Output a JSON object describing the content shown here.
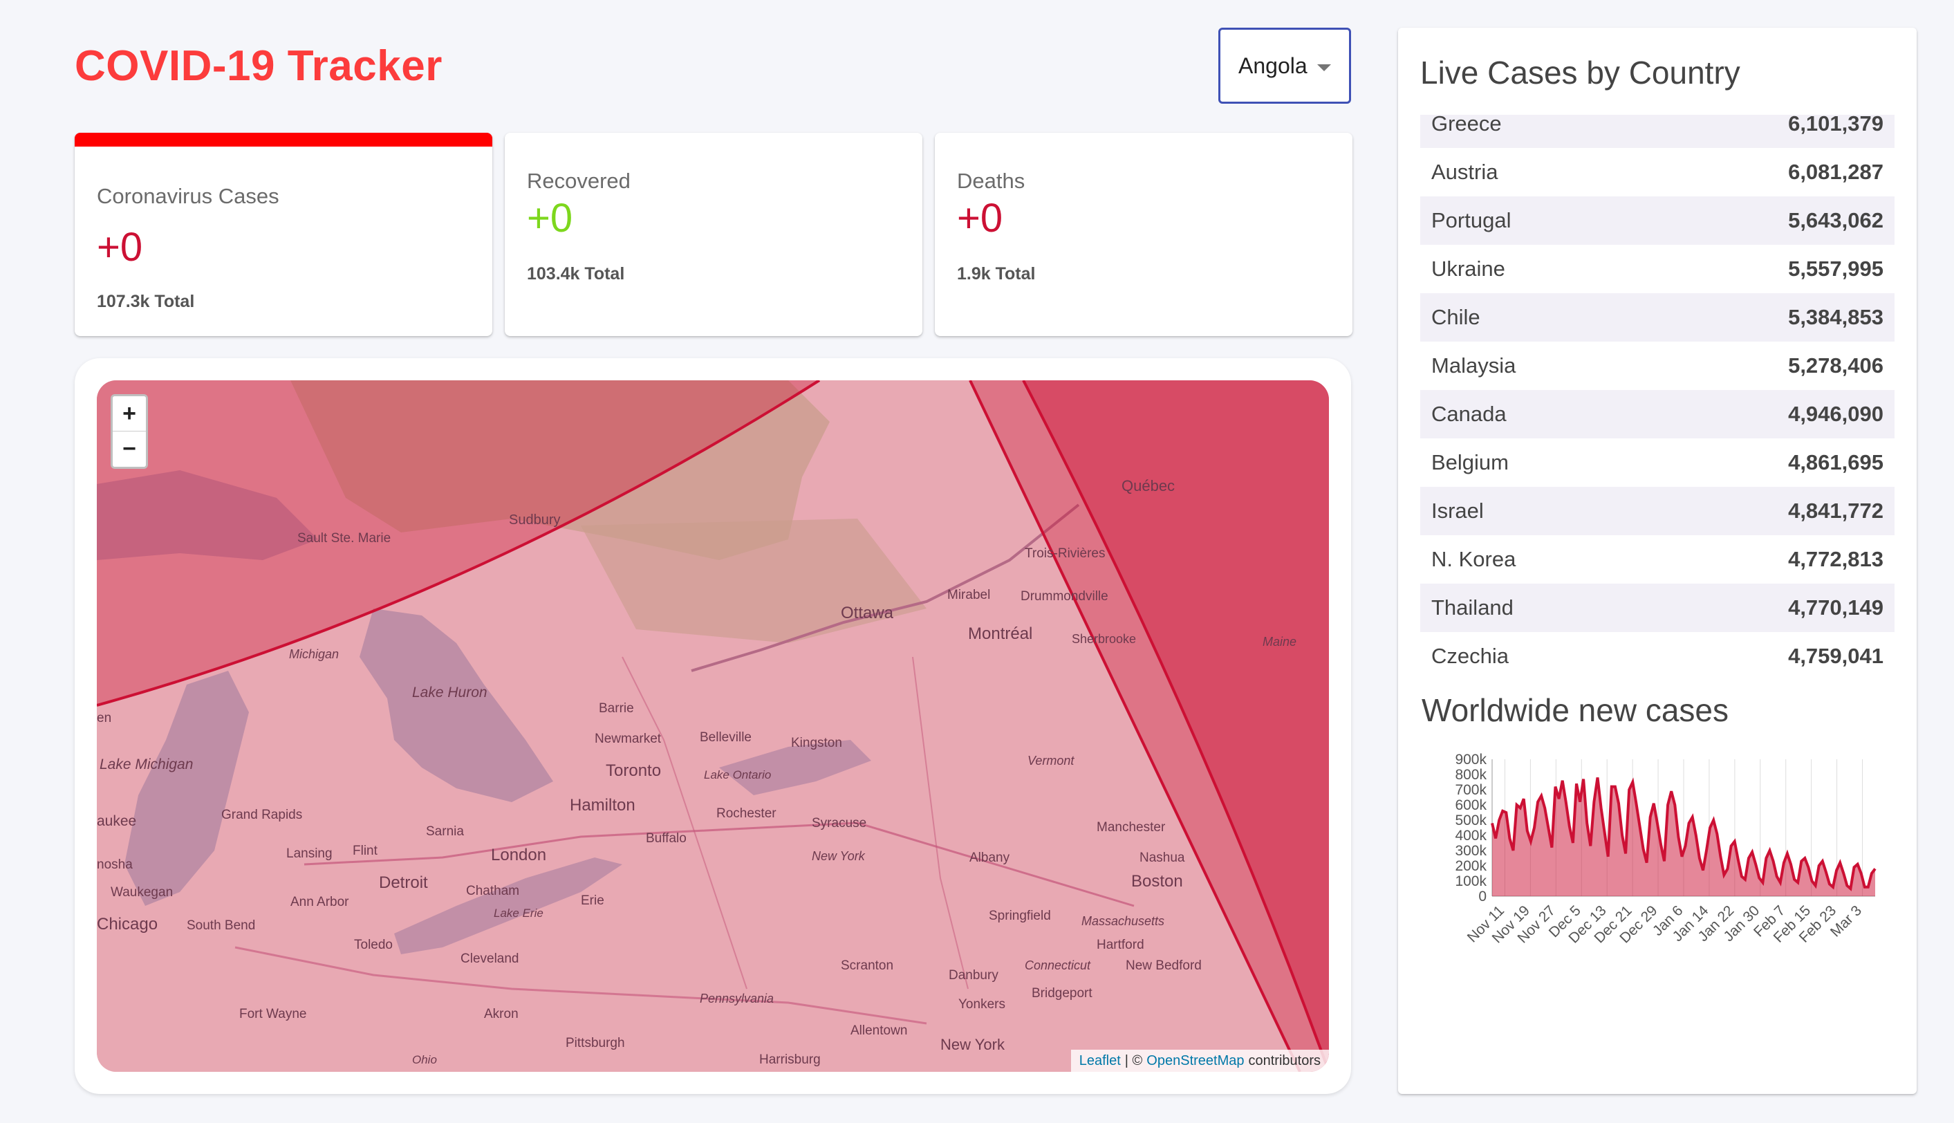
{
  "header": {
    "title": "COVID-19 Tracker"
  },
  "country_select": {
    "selected": "Angola"
  },
  "cards": {
    "cases": {
      "title": "Coronavirus Cases",
      "value": "+0",
      "total": "107.3k Total"
    },
    "recovered": {
      "title": "Recovered",
      "value": "+0",
      "total": "103.4k Total"
    },
    "deaths": {
      "title": "Deaths",
      "value": "+0",
      "total": "1.9k Total"
    }
  },
  "map": {
    "zoom_in": "+",
    "zoom_out": "−",
    "attribution": {
      "leaflet": "Leaflet",
      "sep": "| ©",
      "osm": "OpenStreetMap",
      "suffix": "contributors"
    },
    "labels": [
      {
        "text": "Sudbury"
      },
      {
        "text": "Sault Ste. Marie"
      },
      {
        "text": "Québec"
      },
      {
        "text": "Trois-Rivières"
      },
      {
        "text": "Ottawa"
      },
      {
        "text": "Mirabel"
      },
      {
        "text": "Drummondville"
      },
      {
        "text": "Montréal"
      },
      {
        "text": "Sherbrooke"
      },
      {
        "text": "Maine"
      },
      {
        "text": "Michigan"
      },
      {
        "text": "Lake Huron"
      },
      {
        "text": "Barrie"
      },
      {
        "text": "Newmarket"
      },
      {
        "text": "Belleville"
      },
      {
        "text": "Kingston"
      },
      {
        "text": "Toronto"
      },
      {
        "text": "Lake Ontario"
      },
      {
        "text": "Vermont"
      },
      {
        "text": "Lake Michigan"
      },
      {
        "text": "Hamilton"
      },
      {
        "text": "Rochester"
      },
      {
        "text": "Syracuse"
      },
      {
        "text": "Manchester"
      },
      {
        "text": "Grand Rapids"
      },
      {
        "text": "Sarnia"
      },
      {
        "text": "Buffalo"
      },
      {
        "text": "New York"
      },
      {
        "text": "Albany"
      },
      {
        "text": "Nashua"
      },
      {
        "text": "Lansing"
      },
      {
        "text": "Flint"
      },
      {
        "text": "London"
      },
      {
        "text": "Detroit"
      },
      {
        "text": "Chatham"
      },
      {
        "text": "Boston"
      },
      {
        "text": "Waukegan"
      },
      {
        "text": "Ann Arbor"
      },
      {
        "text": "Erie"
      },
      {
        "text": "Lake Erie"
      },
      {
        "text": "Springfield"
      },
      {
        "text": "Massachusetts"
      },
      {
        "text": "Chicago"
      },
      {
        "text": "South Bend"
      },
      {
        "text": "Toledo"
      },
      {
        "text": "Hartford"
      },
      {
        "text": "Cleveland"
      },
      {
        "text": "Scranton"
      },
      {
        "text": "Connecticut"
      },
      {
        "text": "New Bedford"
      },
      {
        "text": "Danbury"
      },
      {
        "text": "Pennsylvania"
      },
      {
        "text": "Bridgeport"
      },
      {
        "text": "Yonkers"
      },
      {
        "text": "Fort Wayne"
      },
      {
        "text": "Akron"
      },
      {
        "text": "Allentown"
      },
      {
        "text": "Pittsburgh"
      },
      {
        "text": "New York"
      },
      {
        "text": "Ohio"
      },
      {
        "text": "Harrisburg"
      },
      {
        "text": "aukee"
      },
      {
        "text": "nosha"
      },
      {
        "text": "en"
      }
    ]
  },
  "sidebar": {
    "title": "Live Cases by Country",
    "countries": [
      {
        "name": "Greece",
        "cases": "6,101,379"
      },
      {
        "name": "Austria",
        "cases": "6,081,287"
      },
      {
        "name": "Portugal",
        "cases": "5,643,062"
      },
      {
        "name": "Ukraine",
        "cases": "5,557,995"
      },
      {
        "name": "Chile",
        "cases": "5,384,853"
      },
      {
        "name": "Malaysia",
        "cases": "5,278,406"
      },
      {
        "name": "Canada",
        "cases": "4,946,090"
      },
      {
        "name": "Belgium",
        "cases": "4,861,695"
      },
      {
        "name": "Israel",
        "cases": "4,841,772"
      },
      {
        "name": "N. Korea",
        "cases": "4,772,813"
      },
      {
        "name": "Thailand",
        "cases": "4,770,149"
      },
      {
        "name": "Czechia",
        "cases": "4,759,041"
      }
    ],
    "graph_title": "Worldwide new cases"
  },
  "colors": {
    "accent_red": "#cc1034",
    "title_red": "#fc3c3c",
    "recovered_green": "#7dd71d",
    "select_border": "#3f51b5"
  },
  "chart_data": {
    "type": "area",
    "title": "Worldwide new cases",
    "ylim": [
      0,
      900000
    ],
    "yticks": [
      "0",
      "100k",
      "200k",
      "300k",
      "400k",
      "500k",
      "600k",
      "700k",
      "800k",
      "900k"
    ],
    "xticks": [
      "Nov 11",
      "Nov 19",
      "Nov 27",
      "Dec 5",
      "Dec 13",
      "Dec 21",
      "Dec 29",
      "Jan 6",
      "Jan 14",
      "Jan 22",
      "Jan 30",
      "Feb 7",
      "Feb 15",
      "Feb 23",
      "Mar 3"
    ],
    "grid": "vertical",
    "legend": "none",
    "values": [
      480000,
      380000,
      500000,
      560000,
      550000,
      380000,
      300000,
      600000,
      580000,
      640000,
      430000,
      360000,
      450000,
      620000,
      660000,
      580000,
      450000,
      320000,
      720000,
      640000,
      760000,
      620000,
      460000,
      350000,
      740000,
      620000,
      770000,
      480000,
      330000,
      620000,
      780000,
      580000,
      420000,
      260000,
      720000,
      720000,
      610000,
      400000,
      280000,
      700000,
      750000,
      610000,
      460000,
      310000,
      220000,
      520000,
      610000,
      480000,
      340000,
      230000,
      600000,
      690000,
      600000,
      390000,
      260000,
      330000,
      480000,
      520000,
      400000,
      250000,
      170000,
      300000,
      450000,
      500000,
      410000,
      260000,
      140000,
      180000,
      330000,
      360000,
      240000,
      130000,
      110000,
      250000,
      290000,
      210000,
      120000,
      90000,
      250000,
      300000,
      230000,
      130000,
      90000,
      220000,
      280000,
      210000,
      110000,
      90000,
      230000,
      250000,
      190000,
      100000,
      70000,
      200000,
      230000,
      160000,
      80000,
      60000,
      170000,
      220000,
      150000,
      70000,
      50000,
      190000,
      210000,
      150000,
      60000,
      60000,
      150000,
      180000
    ]
  }
}
